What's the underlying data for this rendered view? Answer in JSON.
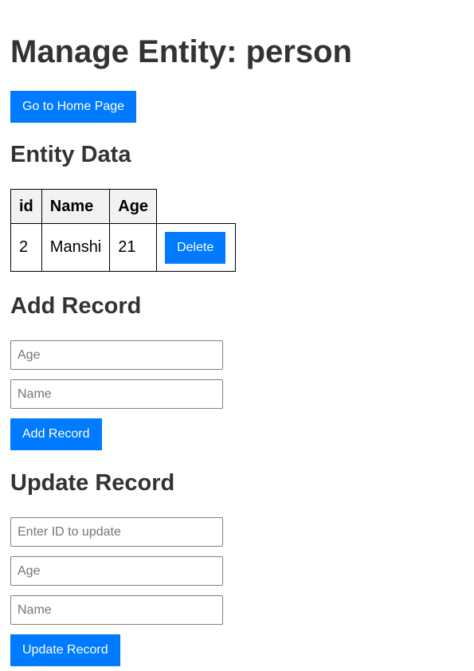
{
  "page": {
    "title": "Manage Entity: person"
  },
  "home_button": {
    "label": "Go to Home Page"
  },
  "entity_data": {
    "heading": "Entity Data",
    "columns": [
      "id",
      "Name",
      "Age"
    ],
    "rows": [
      {
        "id": "2",
        "name": "Manshi",
        "age": "21",
        "action": "Delete"
      }
    ]
  },
  "add_record": {
    "heading": "Add Record",
    "age_placeholder": "Age",
    "name_placeholder": "Name",
    "button_label": "Add Record"
  },
  "update_record": {
    "heading": "Update Record",
    "id_placeholder": "Enter ID to update",
    "age_placeholder": "Age",
    "name_placeholder": "Name",
    "button_label": "Update Record"
  },
  "colors": {
    "accent": "#007bff",
    "text": "#333333",
    "table_header_bg": "#f2f2f2"
  }
}
